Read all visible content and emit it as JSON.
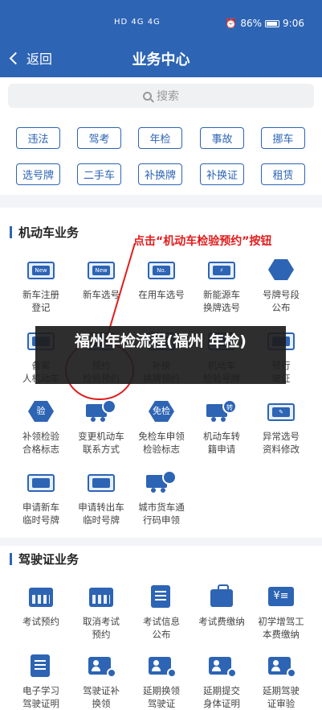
{
  "status": {
    "signal": "HD 4G 4G",
    "battery": "86%",
    "time": "9:06"
  },
  "nav": {
    "back": "返回",
    "title": "业务中心"
  },
  "search": {
    "placeholder": "搜索"
  },
  "quick": [
    "违法",
    "驾考",
    "年检",
    "事故",
    "挪车",
    "选号牌",
    "二手车",
    "补换牌",
    "补换证",
    "租赁"
  ],
  "vehicle": {
    "title": "机动车业务",
    "items": [
      {
        "label": "新车注册\n登记",
        "icon": "new-car-register-icon",
        "tag": "New"
      },
      {
        "label": "新车选号",
        "icon": "new-car-plate-icon",
        "tag": "New"
      },
      {
        "label": "在用车选号",
        "icon": "used-car-plate-icon",
        "tag": "No."
      },
      {
        "label": "新能源车\n换牌选号",
        "icon": "ev-plate-icon",
        "tag": "⚡"
      },
      {
        "label": "号牌号段\n公布",
        "icon": "plate-range-icon",
        "tag": ""
      },
      {
        "label": "备案\n人机动车",
        "icon": "record-icon",
        "tag": ""
      },
      {
        "label": "预约\n检验预约",
        "icon": "inspection-booking-icon",
        "tag": ""
      },
      {
        "label": "补换\n换牌预约",
        "icon": "replace-plate-icon",
        "tag": ""
      },
      {
        "label": "机动车\n检验号牌",
        "icon": "inspection-plate-icon",
        "tag": ""
      },
      {
        "label": "预行\n驶证",
        "icon": "license-icon",
        "tag": ""
      },
      {
        "label": "补领检验\n合格标志",
        "icon": "inspection-mark-icon",
        "tag": "验"
      },
      {
        "label": "变更机动车\n联系方式",
        "icon": "contact-change-icon",
        "tag": ""
      },
      {
        "label": "免检车申领\n检验标志",
        "icon": "exempt-mark-icon",
        "tag": "免检"
      },
      {
        "label": "机动车转\n籍申请",
        "icon": "transfer-icon",
        "tag": "转"
      },
      {
        "label": "异常选号\n资料修改",
        "icon": "abnormal-edit-icon",
        "tag": "✎"
      },
      {
        "label": "申请新车\n临时号牌",
        "icon": "temp-plate-new-icon",
        "tag": ""
      },
      {
        "label": "申请转出车\n临时号牌",
        "icon": "temp-plate-transfer-icon",
        "tag": ""
      },
      {
        "label": "城市货车通\n行码申领",
        "icon": "truck-pass-icon",
        "tag": ""
      }
    ]
  },
  "license": {
    "title": "驾驶证业务",
    "items": [
      {
        "label": "考试预约",
        "icon": "exam-booking-icon",
        "tag": ""
      },
      {
        "label": "取消考试\n预约",
        "icon": "cancel-exam-icon",
        "tag": ""
      },
      {
        "label": "考试信息\n公布",
        "icon": "exam-info-icon",
        "tag": ""
      },
      {
        "label": "考试费缴纳",
        "icon": "exam-fee-icon",
        "tag": ""
      },
      {
        "label": "初学增驾工\n本费缴纳",
        "icon": "fee-payment-icon",
        "tag": "¥≡"
      },
      {
        "label": "电子学习\n驾驶证明",
        "icon": "study-proof-icon",
        "tag": ""
      },
      {
        "label": "驾驶证补\n换领",
        "icon": "license-replace-icon",
        "tag": ""
      },
      {
        "label": "延期换领\n驾驶证",
        "icon": "extend-renew-icon",
        "tag": ""
      },
      {
        "label": "延期提交\n身体证明",
        "icon": "extend-health-icon",
        "tag": ""
      },
      {
        "label": "延期驾驶\n证审验",
        "icon": "extend-review-icon",
        "tag": ""
      }
    ]
  },
  "annotation": {
    "text": "点击“机动车检验预约”按钮"
  },
  "overlay": {
    "text": "福州年检流程(福州 年检)"
  },
  "colors": {
    "primary": "#2d64b4",
    "annotation": "#e21c1c"
  }
}
